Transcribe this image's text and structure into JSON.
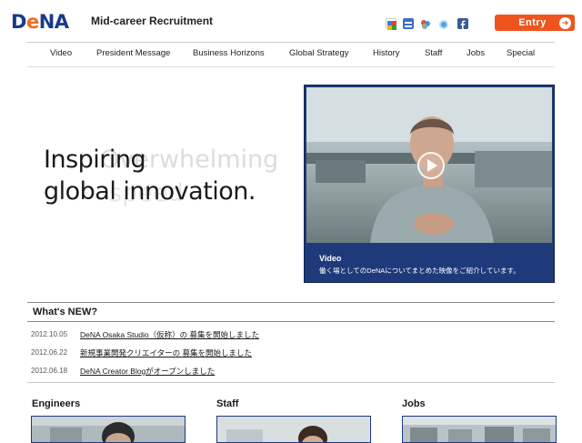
{
  "header": {
    "logo_text": "DeNA",
    "site_title": "Mid-career Recruitment",
    "entry_label": "Entry",
    "social_icons": [
      "google-icon",
      "bookmark-icon",
      "delicious-icon",
      "twitter-icon",
      "facebook-icon"
    ]
  },
  "nav": {
    "items": [
      "Video",
      "President Message",
      "Business Horizons",
      "Global Strategy",
      "History",
      "Staff",
      "Jobs",
      "Special"
    ]
  },
  "hero": {
    "line1": "Inspiring",
    "line2": "global innovation.",
    "ghost_text": "Overwhelming",
    "ghost_text_2": "speed"
  },
  "video": {
    "title": "Video",
    "description": "働く場としてのDeNAについてまとめた映像をご紹介しています。"
  },
  "news": {
    "heading": "What's NEW?",
    "items": [
      {
        "date": "2012.10.05",
        "text": "DeNA Osaka Studio（仮称）の 募集を開始しました"
      },
      {
        "date": "2012.06.22",
        "text": "新規事業開発クリエイターの 募集を開始しました"
      },
      {
        "date": "2012.06.18",
        "text": "DeNA Creator Blogがオープンしました"
      }
    ]
  },
  "categories": [
    "Engineers",
    "Staff",
    "Jobs"
  ],
  "colors": {
    "brand_blue": "#1a3a8a",
    "brand_orange": "#f26b1d",
    "entry_button": "#f0541e",
    "video_panel": "#1e3a7a"
  }
}
